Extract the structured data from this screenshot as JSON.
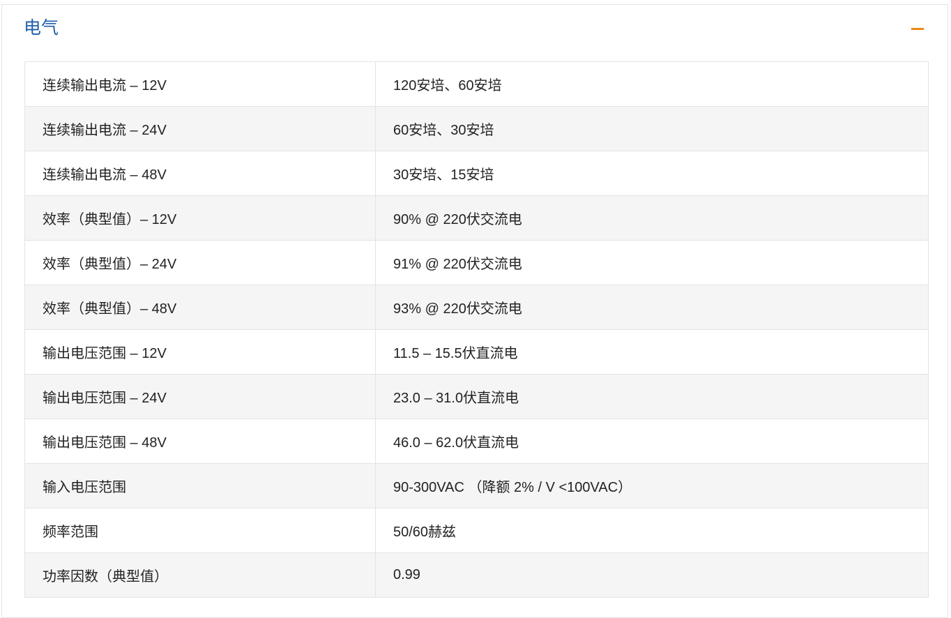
{
  "section": {
    "title": "电气",
    "toggle_icon": "minus-icon",
    "accent_color": "#e88a1a",
    "title_color": "#1f5fa8"
  },
  "specs": [
    {
      "label": "连续输出电流 – 12V",
      "value": "120安培、60安培"
    },
    {
      "label": "连续输出电流 – 24V",
      "value": "60安培、30安培"
    },
    {
      "label": "连续输出电流 – 48V",
      "value": "30安培、15安培"
    },
    {
      "label": "效率（典型值）– 12V",
      "value": "90% @ 220伏交流电"
    },
    {
      "label": "效率（典型值）– 24V",
      "value": "91% @ 220伏交流电"
    },
    {
      "label": "效率（典型值）– 48V",
      "value": "93% @ 220伏交流电"
    },
    {
      "label": "输出电压范围 – 12V",
      "value": "11.5 – 15.5伏直流电"
    },
    {
      "label": "输出电压范围 – 24V",
      "value": "23.0 – 31.0伏直流电"
    },
    {
      "label": "输出电压范围 – 48V",
      "value": "46.0 – 62.0伏直流电"
    },
    {
      "label": "输入电压范围",
      "value": "90-300VAC （降额 2% / V <100VAC）"
    },
    {
      "label": "频率范围",
      "value": "50/60赫兹"
    },
    {
      "label": "功率因数（典型值）",
      "value": "0.99"
    }
  ]
}
